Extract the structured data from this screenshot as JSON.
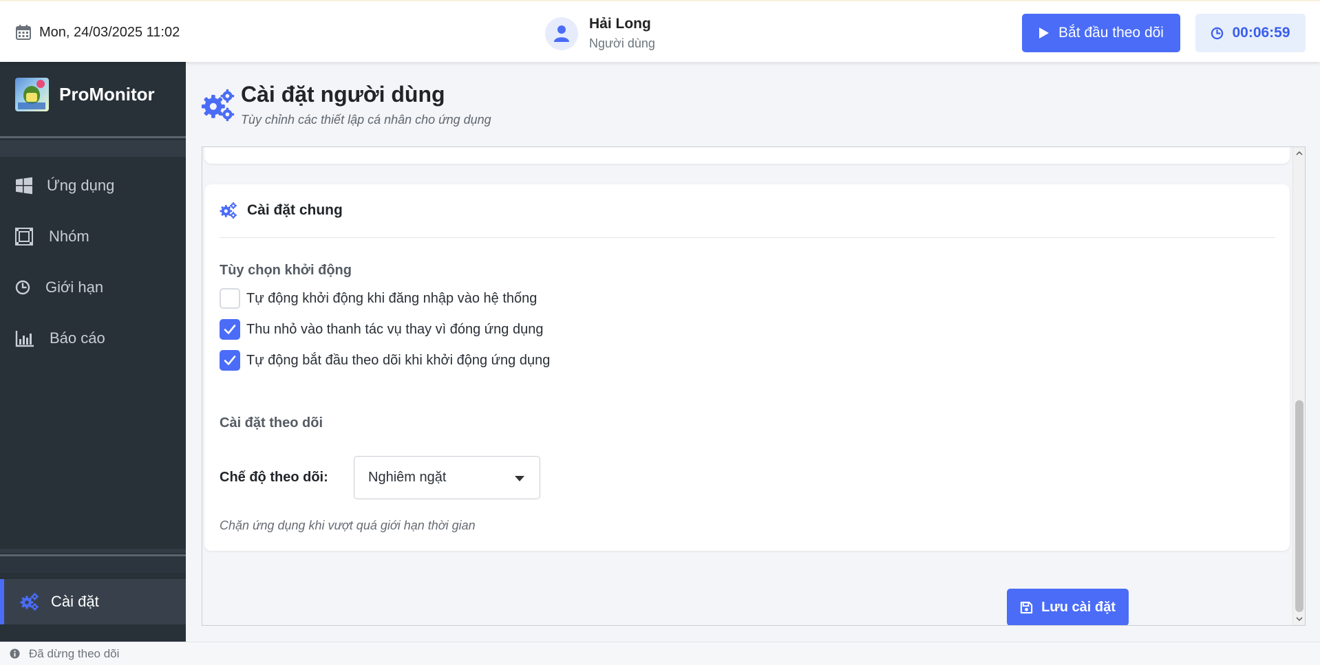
{
  "header": {
    "date": "Mon, 24/03/2025 11:02",
    "user_name": "Hải Long",
    "user_role": "Người dùng",
    "start_button": "Bắt đầu theo dõi",
    "timer": "00:06:59"
  },
  "sidebar": {
    "brand": "ProMonitor",
    "items": [
      {
        "label": "Ứng dụng",
        "icon": "windows-icon"
      },
      {
        "label": "Nhóm",
        "icon": "group-icon"
      },
      {
        "label": "Giới hạn",
        "icon": "clock-icon"
      },
      {
        "label": "Báo cáo",
        "icon": "bar-chart-icon"
      }
    ],
    "settings": {
      "label": "Cài đặt",
      "icon": "gears-icon",
      "active": true
    }
  },
  "page": {
    "title": "Cài đặt người dùng",
    "subtitle": "Tùy chỉnh các thiết lập cá nhân cho ứng dụng"
  },
  "general_settings": {
    "title": "Cài đặt chung",
    "startup_section": "Tùy chọn khởi động",
    "options": [
      {
        "label": "Tự động khởi động khi đăng nhập vào hệ thống",
        "checked": false
      },
      {
        "label": "Thu nhỏ vào thanh tác vụ thay vì đóng ứng dụng",
        "checked": true
      },
      {
        "label": "Tự động bắt đầu theo dõi khi khởi động ứng dụng",
        "checked": true
      }
    ],
    "tracking_section": "Cài đặt theo dõi",
    "mode_label": "Chế độ theo dõi:",
    "mode_value": "Nghiêm ngặt",
    "mode_note": "Chặn ứng dụng khi vượt quá giới hạn thời gian"
  },
  "save_button": "Lưu cài đặt",
  "status": "Đã dừng theo dõi",
  "colors": {
    "accent": "#4a6cf7",
    "sidebar_bg": "#283038",
    "timer_bg": "#e7effd"
  }
}
